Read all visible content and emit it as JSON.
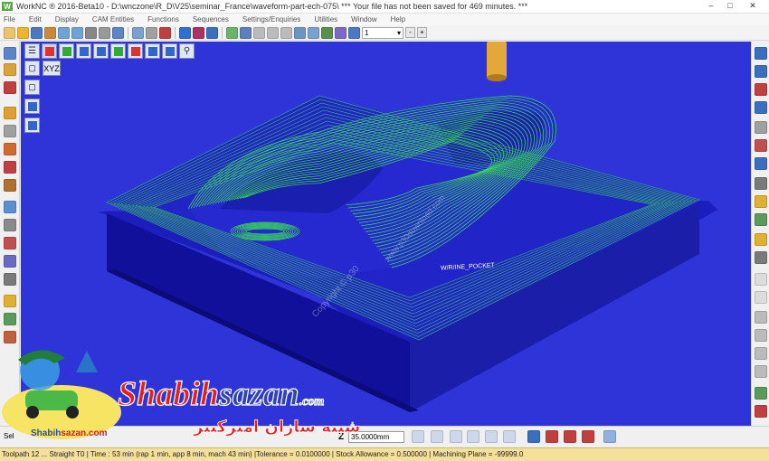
{
  "window": {
    "app_icon": "W",
    "title": "WorkNC ® 2016-Beta10 - D:\\wnczone\\R_D\\V25\\seminar_France\\waveform-part-ech-075\\ *** Your file has not been saved for 469 minutes. ***",
    "controls": {
      "minimize": "–",
      "maximize": "□",
      "close": "✕"
    }
  },
  "menu": [
    "File",
    "Edit",
    "Display",
    "CAM Entities",
    "Functions",
    "Sequences",
    "Settings/Enquiries",
    "Utilities",
    "Window",
    "Help"
  ],
  "toolbar": {
    "layer_value": "1",
    "minus": "-",
    "plus": "+"
  },
  "viewport": {
    "axes_label": "XYZ",
    "watermarks": [
      "Copyright © p30",
      "www.p30download.com"
    ],
    "part_label": "W/R/INE_POCKET"
  },
  "bottom": {
    "left_label": "Sel",
    "z_label": "Z",
    "z_value": "35.0000mm"
  },
  "status": "Toolpath 12 ... Straight T0 | Time : 53 min (rap 1 min, app 8 min, mach 43 min) |Tolerance = 0.0100000 | Stock Allowance = 0.500000 | Machining Plane = -99999.0",
  "branding": {
    "name_part1": "Shabih",
    "name_part2": "sazan",
    "domain": ".com",
    "persian": "شبیه سازان امیرکبیر",
    "mascot_caption_1": "Shabih",
    "mascot_caption_2": "sazan.com"
  },
  "colors": {
    "viewport_bg": "#2f34d8",
    "part_side": "#10109a",
    "part_top": "#1b1dbd",
    "toolpath": "#39e84a",
    "tool_shank": "#e3a83a",
    "status_bg": "#f4df9b",
    "brand_red": "#e51d1d"
  }
}
